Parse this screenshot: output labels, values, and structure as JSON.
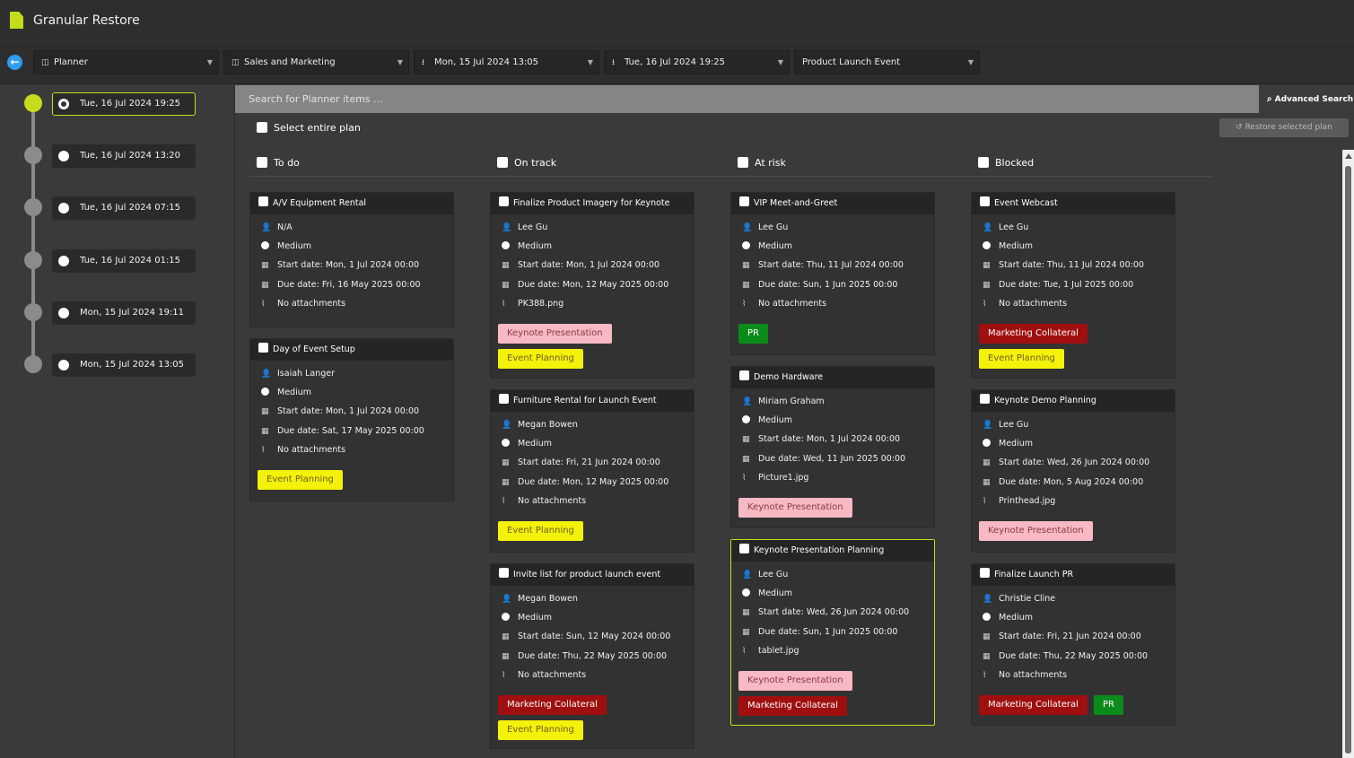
{
  "app": {
    "title": "Granular Restore"
  },
  "toolbar": {
    "planner": "Planner",
    "group": "Sales and Marketing",
    "from_date": "Mon, 15 Jul 2024 13:05",
    "to_date": "Tue, 16 Jul 2024 19:25",
    "plan": "Product Launch Event"
  },
  "timeline": [
    "Tue, 16 Jul 2024 19:25",
    "Tue, 16 Jul 2024 13:20",
    "Tue, 16 Jul 2024 07:15",
    "Tue, 16 Jul 2024 01:15",
    "Mon, 15 Jul 2024 19:11",
    "Mon, 15 Jul 2024 13:05"
  ],
  "search": {
    "placeholder": "Search for Planner items ...",
    "advanced": "Advanced Search"
  },
  "select_plan": "Select entire plan",
  "restore_button": "Restore selected plan",
  "columns": [
    {
      "title": "To do"
    },
    {
      "title": "On track"
    },
    {
      "title": "At risk"
    },
    {
      "title": "Blocked"
    }
  ],
  "cards": {
    "c0_0": {
      "title": "A/V Equipment Rental",
      "assignee": "N/A",
      "priority": "Medium",
      "start": "Start date: Mon, 1 Jul 2024 00:00",
      "due": "Due date: Fri, 16 May 2025 00:00",
      "attachment": "No attachments"
    },
    "c0_1": {
      "title": "Day of Event Setup",
      "assignee": "Isaiah Langer",
      "priority": "Medium",
      "start": "Start date: Mon, 1 Jul 2024 00:00",
      "due": "Due date: Sat, 17 May 2025 00:00",
      "attachment": "No attachments",
      "tags": [
        "Event Planning"
      ]
    },
    "c1_0": {
      "title": "Finalize Product Imagery for Keynote",
      "assignee": "Lee Gu",
      "priority": "Medium",
      "start": "Start date: Mon, 1 Jul 2024 00:00",
      "due": "Due date: Mon, 12 May 2025 00:00",
      "attachment": "PK388.png",
      "tags": [
        "Keynote Presentation",
        "Event Planning"
      ]
    },
    "c1_1": {
      "title": "Furniture Rental for Launch Event",
      "assignee": "Megan Bowen",
      "priority": "Medium",
      "start": "Start date: Fri, 21 Jun 2024 00:00",
      "due": "Due date: Mon, 12 May 2025 00:00",
      "attachment": "No attachments",
      "tags": [
        "Event Planning"
      ]
    },
    "c1_2": {
      "title": "Invite list for product launch event",
      "assignee": "Megan Bowen",
      "priority": "Medium",
      "start": "Start date: Sun, 12 May 2024 00:00",
      "due": "Due date: Thu, 22 May 2025 00:00",
      "attachment": "No attachments",
      "tags": [
        "Marketing Collateral",
        "Event Planning"
      ]
    },
    "c2_0": {
      "title": "VIP Meet-and-Greet",
      "assignee": "Lee Gu",
      "priority": "Medium",
      "start": "Start date: Thu, 11 Jul 2024 00:00",
      "due": "Due date: Sun, 1 Jun 2025 00:00",
      "attachment": "No attachments",
      "tags": [
        "PR"
      ]
    },
    "c2_1": {
      "title": "Demo Hardware",
      "assignee": "Miriam Graham",
      "priority": "Medium",
      "start": "Start date: Mon, 1 Jul 2024 00:00",
      "due": "Due date: Wed, 11 Jun 2025 00:00",
      "attachment": "Picture1.jpg",
      "tags": [
        "Keynote Presentation"
      ]
    },
    "c2_2": {
      "title": "Keynote Presentation Planning",
      "assignee": "Lee Gu",
      "priority": "Medium",
      "start": "Start date: Wed, 26 Jun 2024 00:00",
      "due": "Due date: Sun, 1 Jun 2025 00:00",
      "attachment": "tablet.jpg",
      "tags": [
        "Keynote Presentation",
        "Marketing Collateral"
      ]
    },
    "c3_0": {
      "title": "Event Webcast",
      "assignee": "Lee Gu",
      "priority": "Medium",
      "start": "Start date: Thu, 11 Jul 2024 00:00",
      "due": "Due date: Tue, 1 Jul 2025 00:00",
      "attachment": "No attachments",
      "tags": [
        "Marketing Collateral",
        "Event Planning"
      ]
    },
    "c3_1": {
      "title": "Keynote Demo Planning",
      "assignee": "Lee Gu",
      "priority": "Medium",
      "start": "Start date: Wed, 26 Jun 2024 00:00",
      "due": "Due date: Mon, 5 Aug 2024 00:00",
      "attachment": "Printhead.jpg",
      "tags": [
        "Keynote Presentation"
      ]
    },
    "c3_2": {
      "title": "Finalize Launch PR",
      "assignee": "Christie Cline",
      "priority": "Medium",
      "start": "Start date: Fri, 21 Jun 2024 00:00",
      "due": "Due date: Thu, 22 May 2025 00:00",
      "attachment": "No attachments",
      "tags": [
        "Marketing Collateral",
        "PR"
      ]
    }
  },
  "colors": {
    "accent": "#c5dc1c",
    "tag_pink": "#f7b9c3",
    "tag_yellow": "#f4f10b",
    "tag_red": "#a00f0f",
    "tag_green": "#0b8c1a"
  }
}
